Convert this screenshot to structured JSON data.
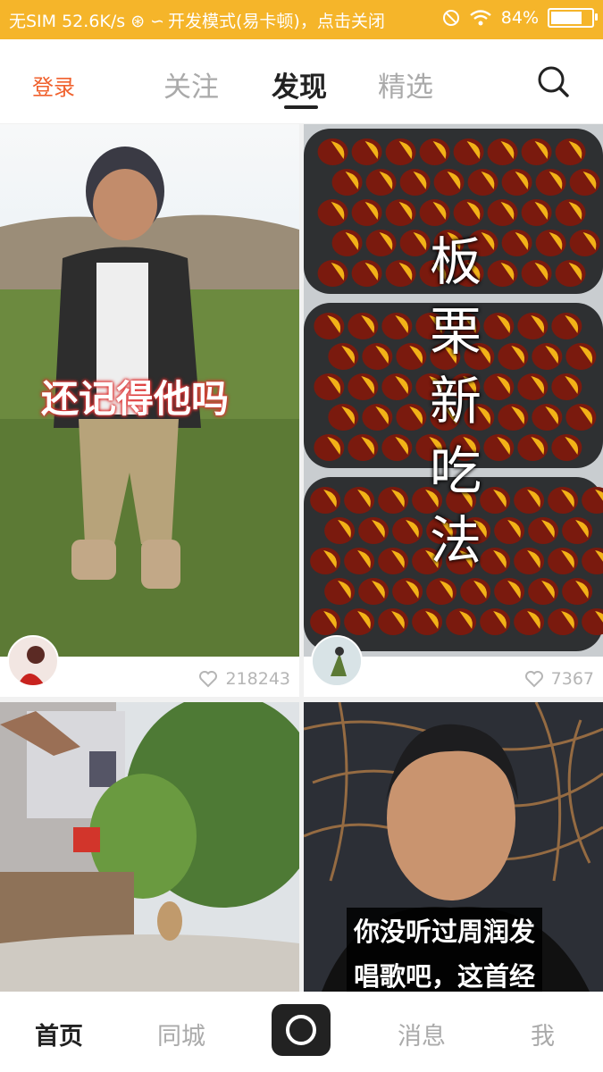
{
  "status_bar": {
    "left_text": "无SIM 52.6K/s ⊛ ∽",
    "center_text": "开发模式(易卡顿)，点击关闭",
    "battery_percent": "84%",
    "battery_level": 0.84
  },
  "top_nav": {
    "login_label": "登录",
    "tabs": [
      {
        "label": "关注",
        "active": false
      },
      {
        "label": "发现",
        "active": true
      },
      {
        "label": "精选",
        "active": false
      }
    ],
    "search_icon": "search-icon"
  },
  "feed": [
    {
      "caption": "还记得他吗",
      "likes": "218243",
      "style": "child-on-grass"
    },
    {
      "caption": "板栗新吃法",
      "likes": "7367",
      "style": "chestnuts"
    },
    {
      "caption": "",
      "likes": "",
      "style": "village-dog"
    },
    {
      "caption_lines": [
        "你没听过周润发",
        "唱歌吧，这首经"
      ],
      "likes": "",
      "style": "man-portrait"
    }
  ],
  "bottom_nav": {
    "items": [
      {
        "label": "首页",
        "active": true
      },
      {
        "label": "同城",
        "active": false
      },
      {
        "label": "消息",
        "active": false
      },
      {
        "label": "我",
        "active": false
      }
    ],
    "camera_icon": "camera-record-icon"
  },
  "colors": {
    "status_bar": "#f5b52a",
    "accent": "#f0612d",
    "active_text": "#222222",
    "inactive_text": "#aaaaaa"
  }
}
